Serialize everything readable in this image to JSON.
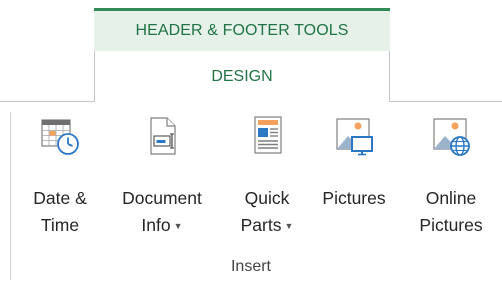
{
  "contextual_tab": {
    "header": "HEADER & FOOTER TOOLS",
    "tab": "DESIGN",
    "accent": "#217346"
  },
  "ribbon": {
    "group_label": "Insert",
    "buttons": [
      {
        "icon": "calendar-clock-icon",
        "line1": "Date &",
        "line2": "Time",
        "dropdown": false
      },
      {
        "icon": "document-info-icon",
        "line1": "Document",
        "line2": "Info",
        "dropdown": true
      },
      {
        "icon": "quick-parts-icon",
        "line1": "Quick",
        "line2": "Parts",
        "dropdown": true
      },
      {
        "icon": "picture-monitor-icon",
        "line1": "Pictures",
        "line2": "",
        "dropdown": false
      },
      {
        "icon": "picture-globe-icon",
        "line1": "Online",
        "line2": "Pictures",
        "dropdown": false
      }
    ]
  }
}
